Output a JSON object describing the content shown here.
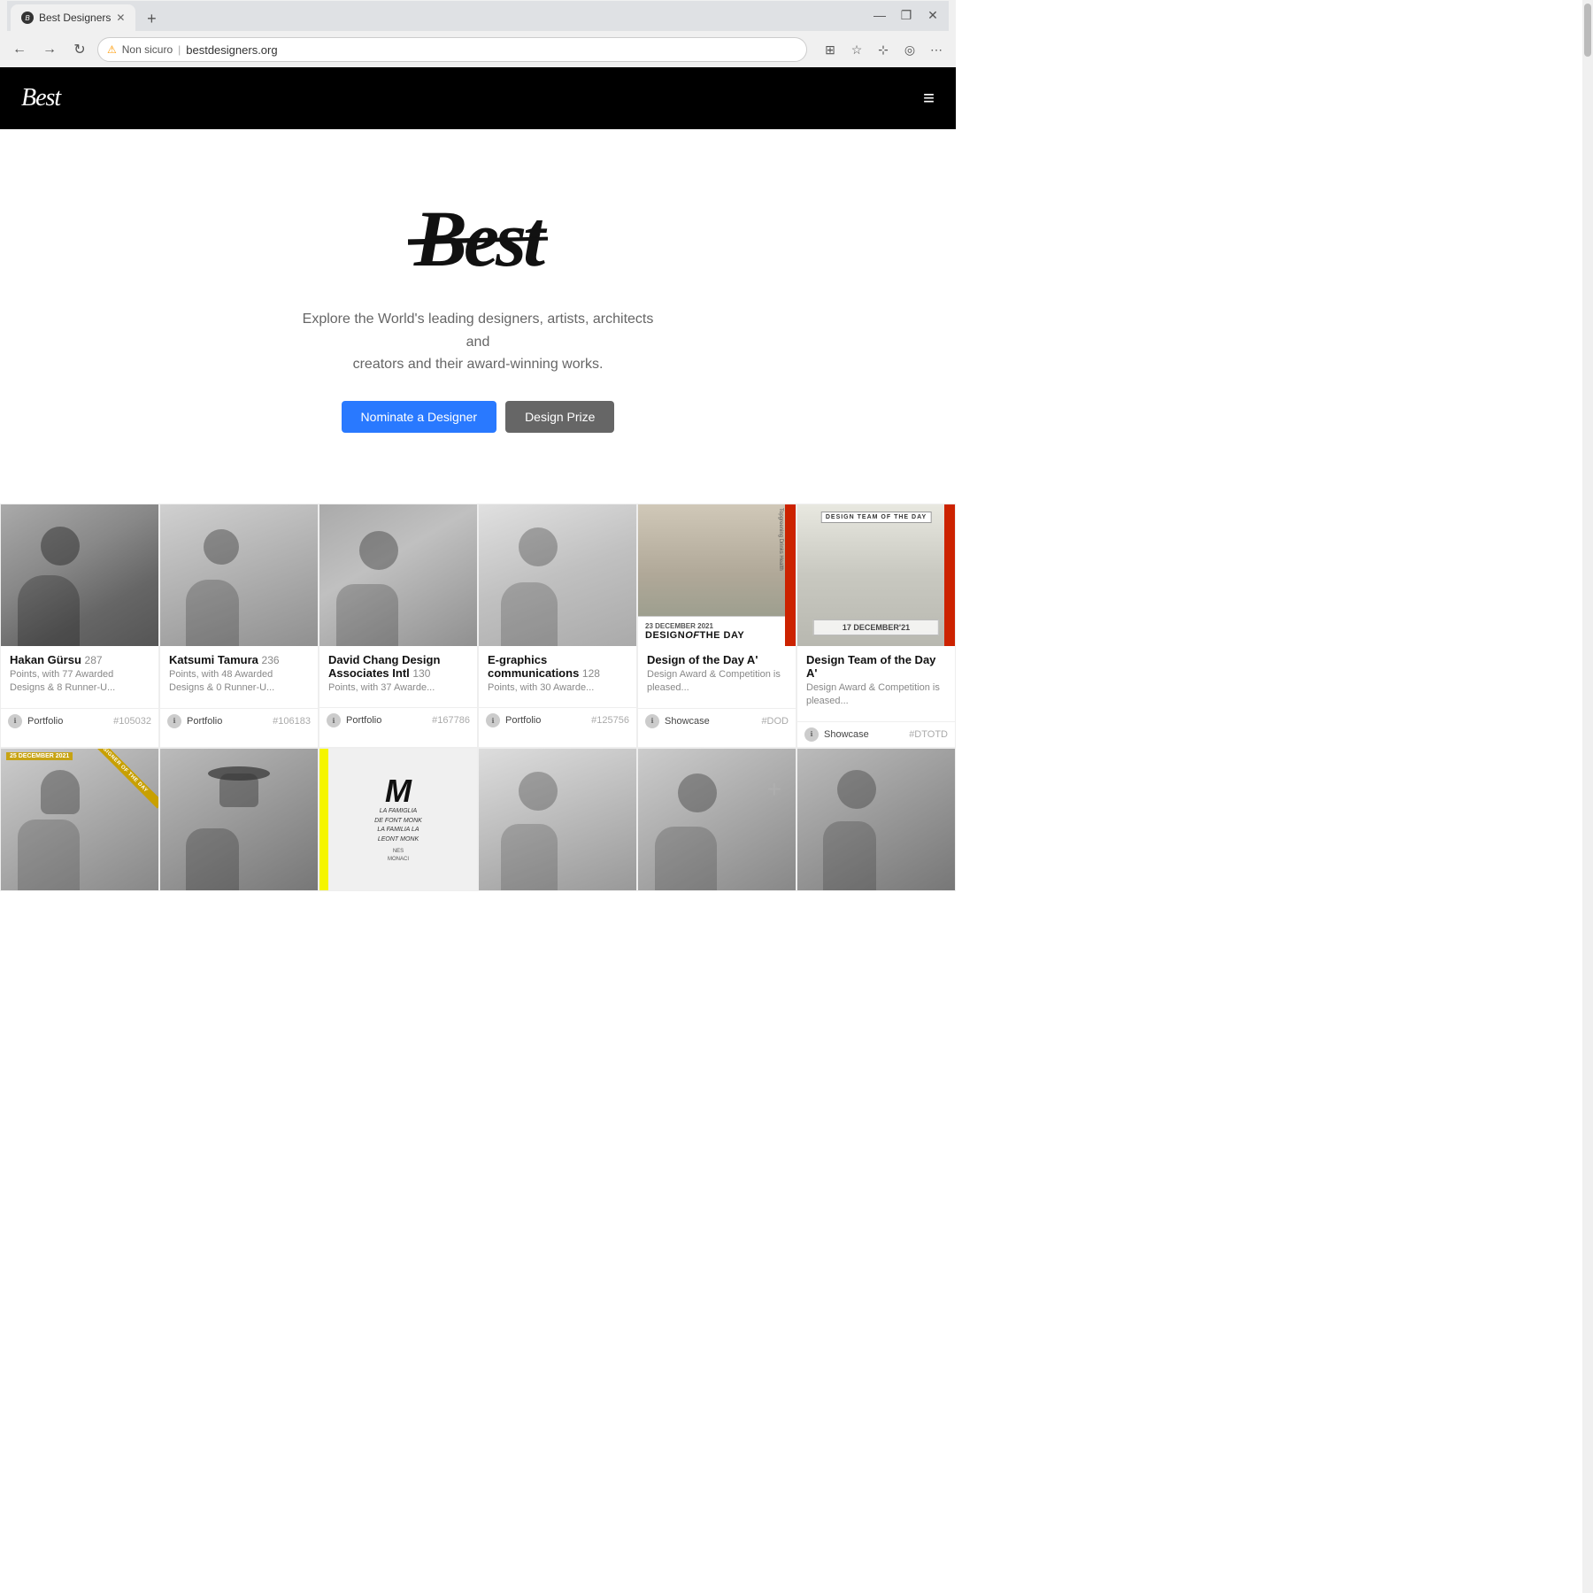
{
  "browser": {
    "tab_title": "Best Designers",
    "tab_favicon": "B",
    "url": "bestdesigners.org",
    "url_warning": "Non sicuro",
    "new_tab_icon": "+",
    "nav_back": "←",
    "nav_forward": "→",
    "nav_refresh": "↻"
  },
  "site": {
    "logo": "Best",
    "hero_logo": "Best",
    "subtitle_line1": "Explore the World's leading designers, artists, architects and",
    "subtitle_line2": "creators and their award-winning works.",
    "btn_nominate": "Nominate a Designer",
    "btn_prize": "Design Prize",
    "hamburger": "≡"
  },
  "cards_row1": [
    {
      "id": "hakan",
      "name": "Hakan Gürsu",
      "points": "287",
      "description": "Points, with 77 Awarded Designs & 8 Runner-U...",
      "link_label": "Portfolio",
      "link_id": "#105032",
      "img_class": "img-hakan"
    },
    {
      "id": "katsumi",
      "name": "Katsumi Tamura",
      "points": "236",
      "description": "Points, with 48 Awarded Designs & 0 Runner-U...",
      "link_label": "Portfolio",
      "link_id": "#106183",
      "img_class": "img-katsumi"
    },
    {
      "id": "david",
      "name": "David Chang Design Associates Intl",
      "points": "130",
      "description": "Points, with 37 Awarde...",
      "link_label": "Portfolio",
      "link_id": "#167786",
      "img_class": "img-david"
    },
    {
      "id": "egraphics",
      "name": "E-graphics communications",
      "points": "128",
      "description": "Points, with 30 Awarde...",
      "link_label": "Portfolio",
      "link_id": "#125756",
      "img_class": "img-egraphics"
    },
    {
      "id": "dod",
      "name": "Design of the Day",
      "description": "Design of the Day A' Design Award & Competition is pleased...",
      "link_label": "Showcase",
      "link_id": "#DOD",
      "dod_date": "23 DECEMBER 2021",
      "is_showcase": true
    },
    {
      "id": "dtotd",
      "name": "Design Team of the Day",
      "description": "Design Team of the Day A' Design Award & Competition is pleased...",
      "link_label": "Showcase",
      "link_id": "#DTOTD",
      "is_showcase": true
    }
  ],
  "cards_row2": [
    {
      "id": "person5",
      "name": "",
      "img_class": "img-person5",
      "has_ribbon": true,
      "ribbon_text": "DESIGNER OF THE DAY",
      "is_person": true
    },
    {
      "id": "person6",
      "name": "",
      "img_class": "img-person6",
      "is_person": true
    },
    {
      "id": "book",
      "name": "",
      "img_class": "img-book",
      "is_book": true,
      "book_text": "LA FAMIGLIA DE FONT MONK LA FAMILIA LA FONT MONK"
    },
    {
      "id": "person8",
      "name": "",
      "img_class": "img-person8",
      "is_person": true
    },
    {
      "id": "person9",
      "name": "",
      "img_class": "img-person9",
      "is_person": true
    },
    {
      "id": "person10",
      "name": "",
      "img_class": "img-person10",
      "is_person": true
    }
  ],
  "icons": {
    "info": "ℹ",
    "hamburger": "≡",
    "close": "✕",
    "star": "☆",
    "bookmark": "⊹",
    "extensions": "⊞",
    "profile": "◯",
    "more": "⋯"
  }
}
